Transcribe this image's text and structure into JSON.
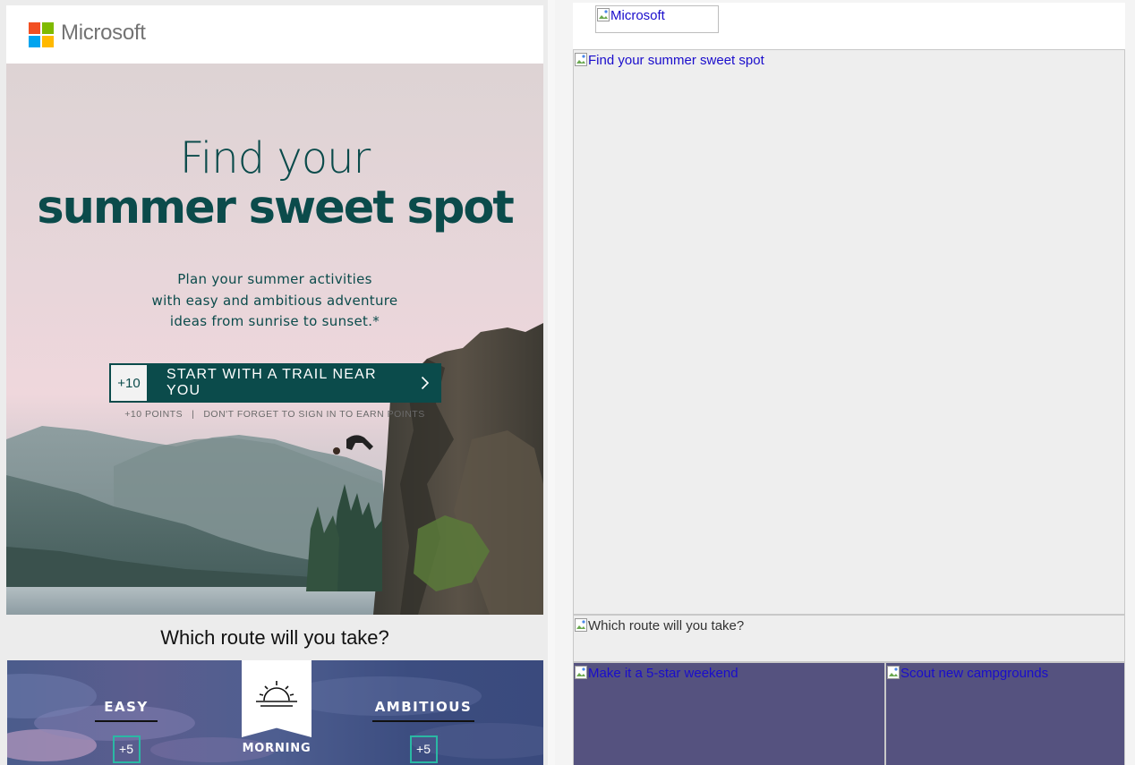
{
  "brand": {
    "name": "Microsoft",
    "logo_colors": [
      "#f25022",
      "#7fba00",
      "#00a4ef",
      "#ffb900"
    ]
  },
  "hero": {
    "title_line1": "Find your",
    "title_line2": "summer sweet spot",
    "description_lines": [
      "Plan your summer activities",
      "with easy and ambitious adventure",
      "ideas from sunrise to sunset.*"
    ],
    "cta": {
      "points": "+10",
      "label": "START WITH A TRAIL NEAR YOU"
    },
    "note_points": "+10 POINTS",
    "note_separator": "|",
    "note_text": "DON'T FORGET TO SIGN IN TO EARN POINTS"
  },
  "route": {
    "heading": "Which route will you take?",
    "easy_label": "EASY",
    "easy_points": "+5",
    "morning_label": "MORNING",
    "ambitious_label": "AMBITIOUS",
    "ambitious_points": "+5"
  },
  "images_off": {
    "logo_alt": "Microsoft",
    "hero_alt": "Find your summer sweet spot",
    "route_alt": "Which route will you take?",
    "weekend_alt": "Make it a 5-star weekend",
    "campgrounds_alt": "Scout new campgrounds"
  },
  "colors": {
    "accent_teal": "#0b4b4b",
    "points_border": "#2ab8a4",
    "link_blue": "#1a0dcc",
    "placeholder_purple": "#55527f"
  }
}
